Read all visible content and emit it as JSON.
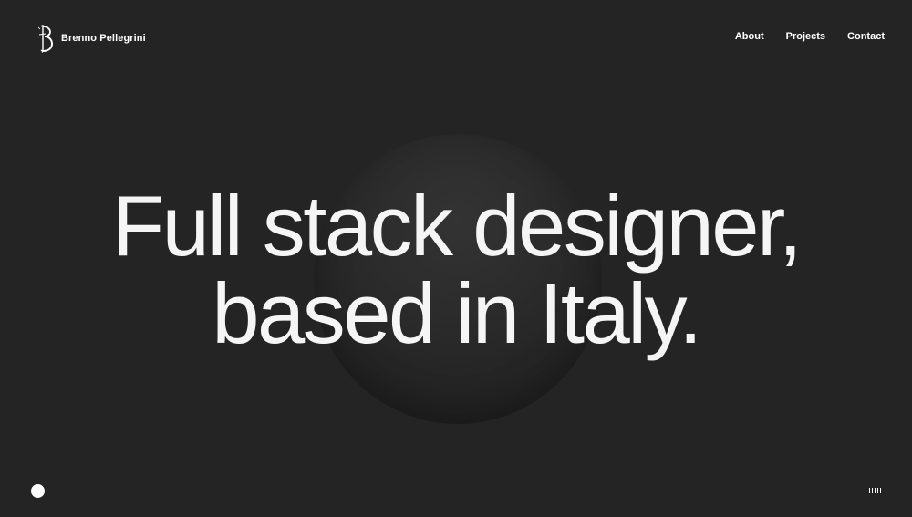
{
  "header": {
    "brand_name": "Brenno Pellegrini",
    "logo_icon": "brenno-monogram-logo",
    "nav": [
      {
        "label": "About"
      },
      {
        "label": "Projects"
      },
      {
        "label": "Contact"
      }
    ]
  },
  "hero": {
    "line1": "Full stack designer,",
    "line2": "based in Italy."
  },
  "indicators": {
    "left_icon": "cursor-dot-icon",
    "right_icon": "sound-bars-icon"
  },
  "colors": {
    "background": "#242424",
    "text": "#ffffff",
    "orb": "#2e2e2e"
  }
}
